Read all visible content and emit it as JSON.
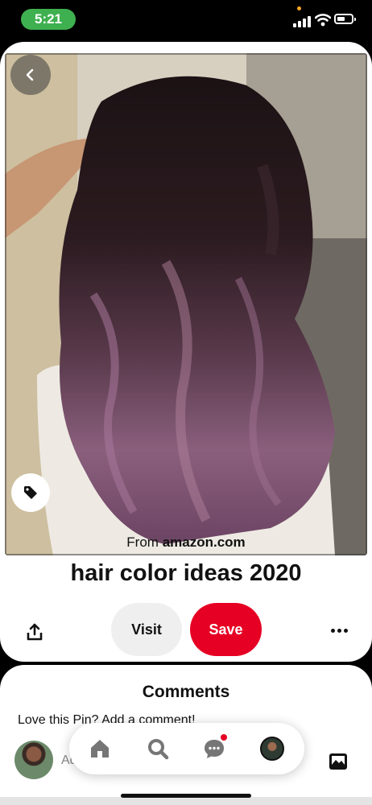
{
  "status_bar": {
    "time": "5:21",
    "colors": {
      "time_pill": "#3fb04f",
      "indicator_dot": "#f5a623"
    }
  },
  "pin": {
    "from_prefix": "From",
    "source_domain": "amazon.com",
    "title": "hair color ideas 2020",
    "visit_label": "Visit",
    "save_label": "Save"
  },
  "icons": {
    "back": "chevron-left-icon",
    "tag": "tag-icon",
    "share": "share-icon",
    "more": "more-horizontal-icon",
    "home": "home-icon",
    "search": "search-icon",
    "messages": "chat-bubble-icon",
    "gallery": "image-icon"
  },
  "comments": {
    "title": "Comments",
    "prompt": "Love this Pin? Add a comment!",
    "input_partial": "Ad"
  },
  "colors": {
    "save": "#e60023",
    "visit": "#efefef",
    "notification": "#e60023"
  }
}
